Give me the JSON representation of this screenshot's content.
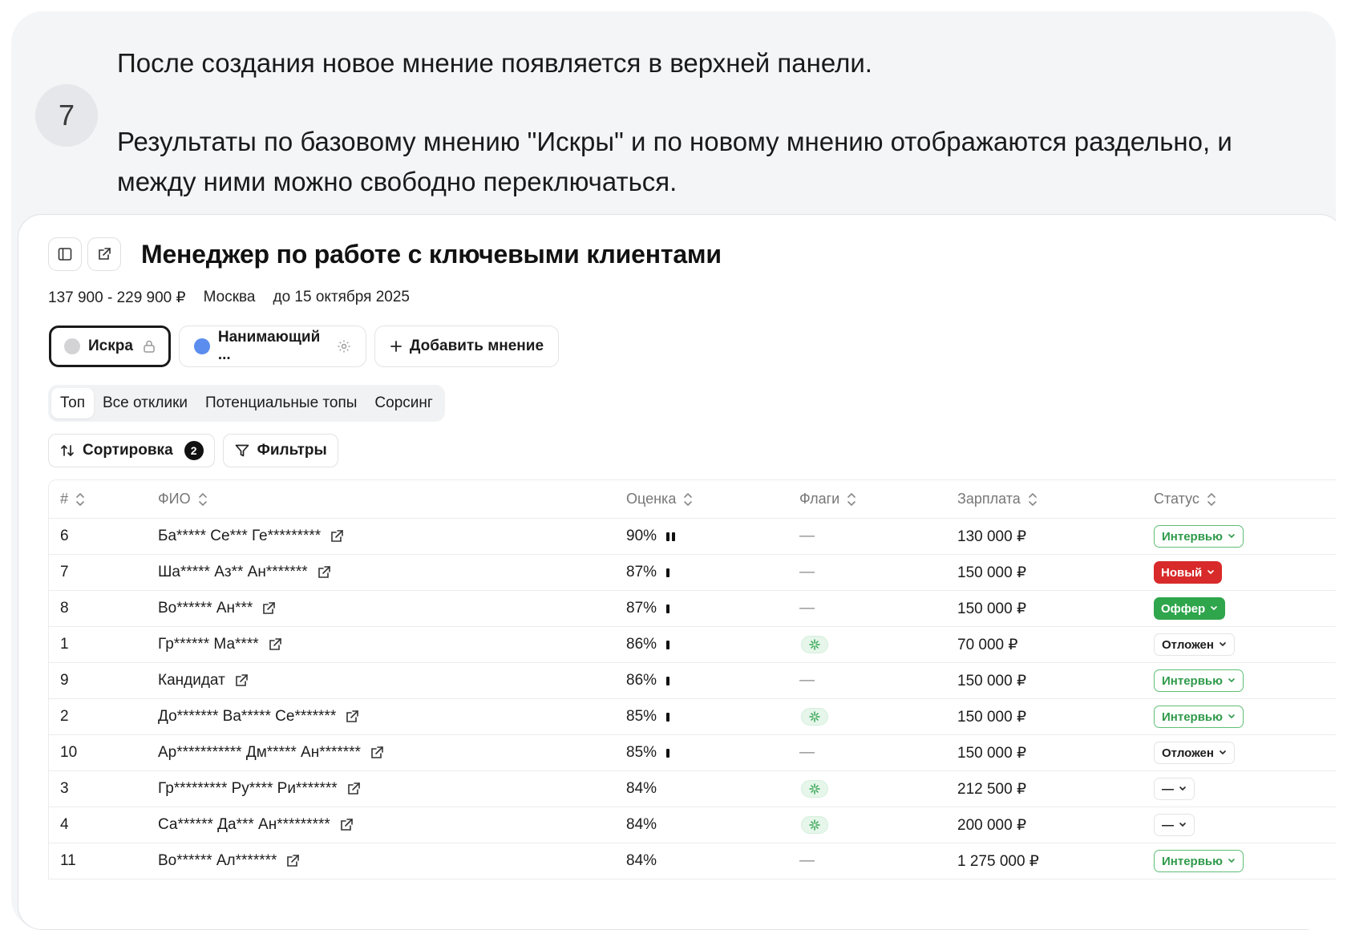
{
  "step": {
    "number": "7",
    "line1": "После создания новое мнение появляется в верхней панели.",
    "line2": "Результаты по базовому мнению \"Искры\" и по новому мнению отображаются раздельно, и между ними можно свободно переключаться."
  },
  "vacancy": {
    "title": "Менеджер по работе с ключевыми клиентами",
    "salary": "137 900 - 229 900 ₽",
    "city": "Москва",
    "deadline": "до 15 октября 2025"
  },
  "opinions": {
    "base_label": "Искра",
    "new_label": "Нанимающий ...",
    "add_label": "Добавить мнение",
    "base_dot_color": "#d3d3d6",
    "new_dot_color": "#5b8def"
  },
  "tabs": [
    "Топ",
    "Все отклики",
    "Потенциальные топы",
    "Сорсинг"
  ],
  "controls": {
    "sort_label": "Сортировка",
    "sort_count": "2",
    "filters_label": "Фильтры"
  },
  "table": {
    "columns": [
      "#",
      "ФИО",
      "Оценка",
      "Флаги",
      "Зарплата",
      "Статус"
    ],
    "rows": [
      {
        "num": "6",
        "fio": "Ба***** Се*** Ге*********",
        "score": "90%",
        "bars": 2,
        "flag": "—",
        "salary": "130 000 ₽",
        "status": "Интервью",
        "status_type": "interview"
      },
      {
        "num": "7",
        "fio": "Ша***** Аз** Ан*******",
        "score": "87%",
        "bars": 1,
        "flag": "—",
        "salary": "150 000 ₽",
        "status": "Новый",
        "status_type": "new"
      },
      {
        "num": "8",
        "fio": "Во****** Ан***",
        "score": "87%",
        "bars": 1,
        "flag": "—",
        "salary": "150 000 ₽",
        "status": "Оффер",
        "status_type": "offer"
      },
      {
        "num": "1",
        "fio": "Гр****** Ма****",
        "score": "86%",
        "bars": 1,
        "flag": "sparkle",
        "salary": "70 000 ₽",
        "status": "Отложен",
        "status_type": "postponed"
      },
      {
        "num": "9",
        "fio": "Кандидат",
        "score": "86%",
        "bars": 1,
        "flag": "—",
        "salary": "150 000 ₽",
        "status": "Интервью",
        "status_type": "interview"
      },
      {
        "num": "2",
        "fio": "До******* Ва***** Се*******",
        "score": "85%",
        "bars": 1,
        "flag": "sparkle",
        "salary": "150 000 ₽",
        "status": "Интервью",
        "status_type": "interview"
      },
      {
        "num": "10",
        "fio": "Ар*********** Дм***** Ан*******",
        "score": "85%",
        "bars": 1,
        "flag": "—",
        "salary": "150 000 ₽",
        "status": "Отложен",
        "status_type": "postponed"
      },
      {
        "num": "3",
        "fio": "Гр********* Ру**** Ри*******",
        "score": "84%",
        "bars": 0,
        "flag": "sparkle",
        "salary": "212 500 ₽",
        "status": "—",
        "status_type": "none"
      },
      {
        "num": "4",
        "fio": "Са****** Да*** Ан*********",
        "score": "84%",
        "bars": 0,
        "flag": "sparkle",
        "salary": "200 000 ₽",
        "status": "—",
        "status_type": "none"
      },
      {
        "num": "11",
        "fio": "Во****** Ал*******",
        "score": "84%",
        "bars": 0,
        "flag": "—",
        "salary": "1 275 000 ₽",
        "status": "Интервью",
        "status_type": "interview"
      }
    ]
  }
}
